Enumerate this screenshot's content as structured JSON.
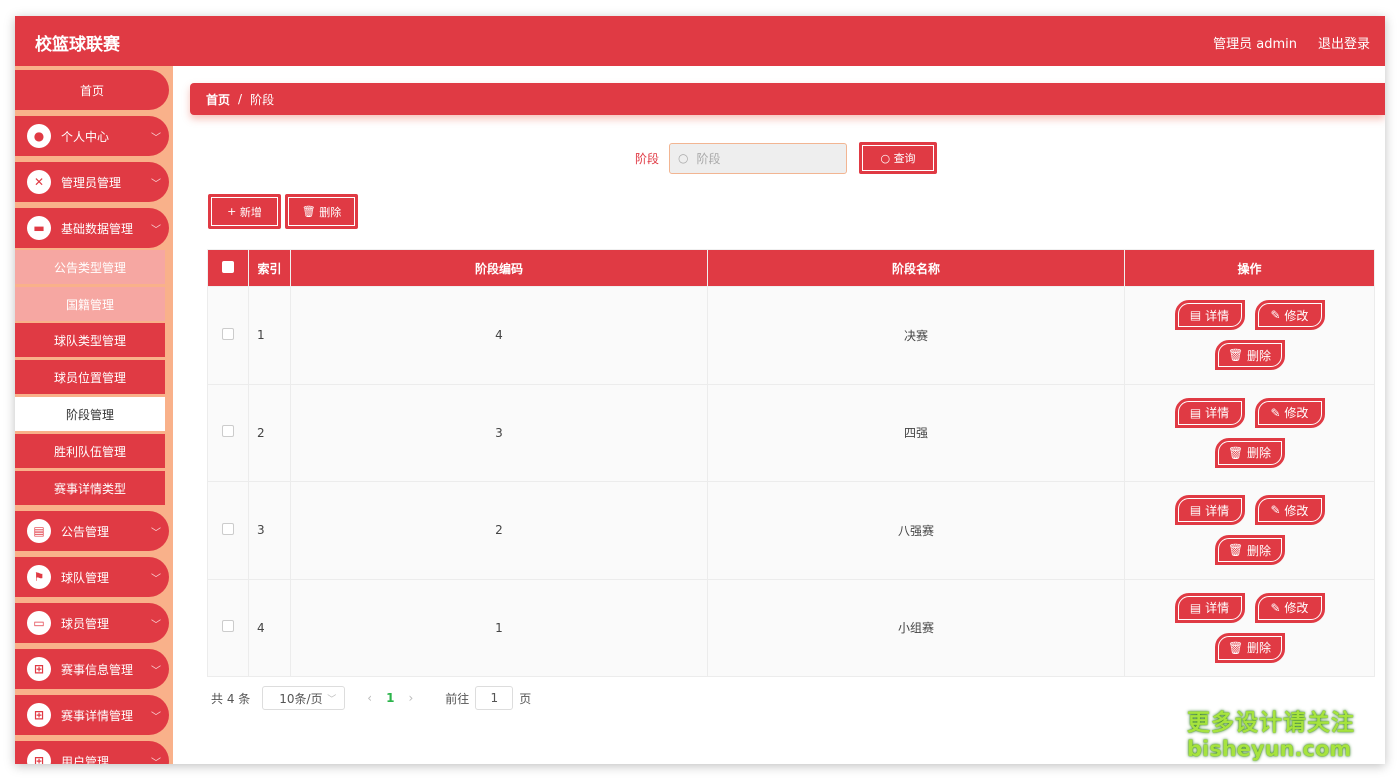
{
  "app": {
    "title": "校篮球联赛",
    "user": "管理员 admin",
    "logout": "退出登录"
  },
  "sidebar": {
    "home": "首页",
    "menus": [
      {
        "label": "个人中心",
        "icon": "user-icon"
      },
      {
        "label": "管理员管理",
        "icon": "admin-icon"
      },
      {
        "label": "基础数据管理",
        "icon": "briefcase-icon"
      }
    ],
    "sub": [
      {
        "label": "公告类型管理"
      },
      {
        "label": "国籍管理"
      },
      {
        "label": "球队类型管理"
      },
      {
        "label": "球员位置管理"
      },
      {
        "label": "阶段管理"
      },
      {
        "label": "胜利队伍管理"
      },
      {
        "label": "赛事详情类型"
      }
    ],
    "menus2": [
      {
        "label": "公告管理",
        "icon": "clipboard-icon"
      },
      {
        "label": "球队管理",
        "icon": "flag-icon"
      },
      {
        "label": "球员管理",
        "icon": "monitor-icon"
      },
      {
        "label": "赛事信息管理",
        "icon": "grid-icon"
      },
      {
        "label": "赛事详情管理",
        "icon": "grid-icon"
      },
      {
        "label": "用户管理",
        "icon": "grid-icon"
      }
    ]
  },
  "breadcrumb": {
    "home": "首页",
    "sep": "/",
    "current": "阶段"
  },
  "search": {
    "label": "阶段",
    "placeholder": "阶段",
    "button": "查询"
  },
  "actions": {
    "add": "新增",
    "delete": "删除"
  },
  "table": {
    "headers": [
      "索引",
      "阶段编码",
      "阶段名称",
      "操作"
    ],
    "rows": [
      {
        "index": "1",
        "code": "4",
        "name": "决赛"
      },
      {
        "index": "2",
        "code": "3",
        "name": "四强"
      },
      {
        "index": "3",
        "code": "2",
        "name": "八强赛"
      },
      {
        "index": "4",
        "code": "1",
        "name": "小组赛"
      }
    ],
    "ops": {
      "detail": "详情",
      "edit": "修改",
      "delete": "删除"
    }
  },
  "pager": {
    "total": "共 4 条",
    "size": "10条/页",
    "current": "1",
    "goto": "前往",
    "page_value": "1",
    "page_unit": "页"
  },
  "watermark": {
    "line1": "更多设计请关注",
    "line2": "bisheyun.com"
  },
  "colors": {
    "primary": "#e03a44",
    "sidebar_bg": "#f9b18a"
  }
}
